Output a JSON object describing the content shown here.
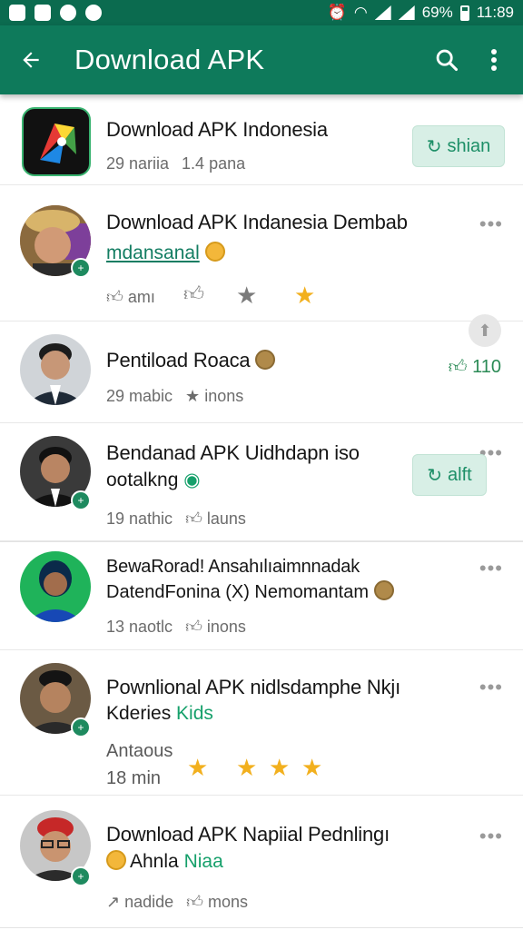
{
  "status_bar": {
    "battery": "69%",
    "time": "11:89"
  },
  "app_bar": {
    "title": "Download APK"
  },
  "items": [
    {
      "name": "Download APK Indonesia",
      "meta1": "29 nariia",
      "meta2": "1.4 pana",
      "action": "shian"
    },
    {
      "name": "Download APK Indanesia Dembab",
      "sub": "mdansanal",
      "meta1": "amı"
    },
    {
      "name": "Pentiload Roaca",
      "meta1": "29 mabic",
      "meta2": "inons",
      "likes": "110"
    },
    {
      "name": "Bendanad APK Uidhdapn iso",
      "sub": "ootalkng",
      "meta1": "19 nathic",
      "meta2": "launs",
      "action": "alft"
    },
    {
      "name": "BewaRorad! Ansahılıaimnnadak",
      "sub": "DatendFonina (X) Nemomantam",
      "meta1": "13 naotlc",
      "meta2": "inons"
    },
    {
      "name": "Pownlional APK nidlsdamphe Nkjı",
      "sub_black": "Kderies",
      "sub_green": "Kids",
      "meta0": "Antaous",
      "meta1": "18 min"
    },
    {
      "name": "Download APK Napiial Pednlingı",
      "sub_black": "Ahnla",
      "sub_green": "Niaa",
      "meta1": "nadide",
      "meta2": "mons"
    }
  ]
}
